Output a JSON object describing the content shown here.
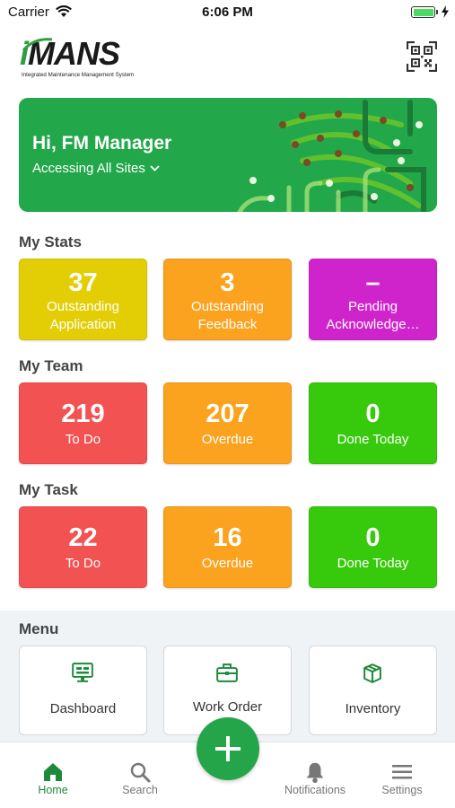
{
  "status_bar": {
    "carrier": "Carrier",
    "time": "6:06 PM"
  },
  "header": {
    "logo_text_i": "i",
    "logo_text_rest": "MANS",
    "logo_tagline": "Integrated Maintenance Management System",
    "qr_icon": "qr-code-icon"
  },
  "banner": {
    "greeting": "Hi, FM Manager",
    "site_selector": "Accessing All Sites"
  },
  "my_stats": {
    "title": "My Stats",
    "cards": [
      {
        "value": "37",
        "label_line1": "Outstanding",
        "label_line2": "Application",
        "color": "#e3ce06"
      },
      {
        "value": "3",
        "label_line1": "Outstanding",
        "label_line2": "Feedback",
        "color": "#fba21e"
      },
      {
        "value": "–",
        "label_line1": "Pending",
        "label_line2": "Acknowledge…",
        "color": "#cf24cc"
      }
    ]
  },
  "my_team": {
    "title": "My Team",
    "cards": [
      {
        "value": "219",
        "label": "To Do",
        "color": "#f25252"
      },
      {
        "value": "207",
        "label": "Overdue",
        "color": "#fba21e"
      },
      {
        "value": "0",
        "label": "Done Today",
        "color": "#37c90b"
      }
    ]
  },
  "my_task": {
    "title": "My Task",
    "cards": [
      {
        "value": "22",
        "label": "To Do",
        "color": "#f25252"
      },
      {
        "value": "16",
        "label": "Overdue",
        "color": "#fba21e"
      },
      {
        "value": "0",
        "label": "Done Today",
        "color": "#37c90b"
      }
    ]
  },
  "menu": {
    "title": "Menu",
    "items": [
      {
        "label": "Dashboard",
        "icon": "monitor-dashboard-icon"
      },
      {
        "label": "Work Order",
        "icon": "briefcase-icon"
      },
      {
        "label": "Inventory",
        "icon": "box-icon"
      }
    ]
  },
  "tab_bar": {
    "items": [
      {
        "label": "Home",
        "icon": "home-icon",
        "active": true
      },
      {
        "label": "Search",
        "icon": "search-icon"
      },
      {
        "label": "Notifications",
        "icon": "bell-icon"
      },
      {
        "label": "Settings",
        "icon": "menu-lines-icon"
      }
    ],
    "fab_icon": "plus-icon"
  },
  "colors": {
    "brand_green": "#22a74a",
    "active_tab": "#1d8a3b",
    "fab": "#25a54a"
  }
}
